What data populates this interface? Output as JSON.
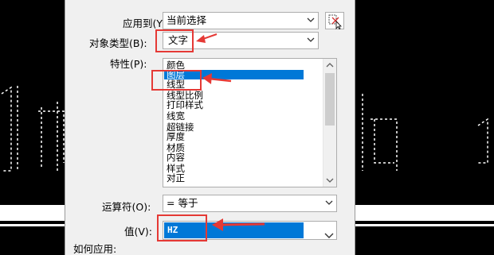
{
  "dialog": {
    "apply_to_label": "应用到(Y):",
    "apply_to_value": "当前选择",
    "object_type_label": "对象类型(B):",
    "object_type_value": "文字",
    "properties_label": "特性(P):",
    "properties_items": [
      "颜色",
      "图层",
      "线型",
      "线型比例",
      "打印样式",
      "线宽",
      "超链接",
      "厚度",
      "材质",
      "内容",
      "样式",
      "对正"
    ],
    "properties_selected_index": 1,
    "operator_label": "运算符(O):",
    "operator_value": "= 等于",
    "value_label": "值(V):",
    "value_value": "HZ",
    "how_to_apply_label": "如何应用:"
  },
  "icons": {
    "pick_button": "select-objects-icon",
    "dropdown": "chevron-down-icon"
  },
  "colors": {
    "selection": "#0078d7",
    "annotation": "#e53935",
    "cad_background": "#000000"
  }
}
